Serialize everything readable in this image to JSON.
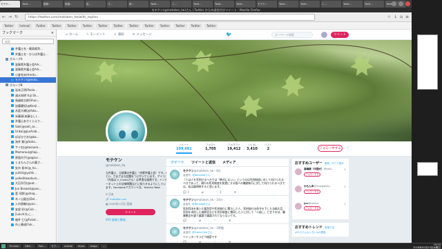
{
  "browser": {
    "tabs": [
      "モテケ…",
      "Twitt…",
      "国際…",
      "英国…",
      "民…",
      "コ…",
      "新…",
      "Twitt…",
      "ニ…",
      "Twitt…",
      "Twitt…",
      "Twitt…",
      "モテケ…",
      "Twitt…",
      "Twitt…",
      "ニ…",
      "Twitt…",
      "Twitt…",
      "Twitt…"
    ],
    "active_tab_index": 0,
    "window_title": "モテケン(@motoken_tw)さん | Twitter からの返信付きツイート - Mozilla Firefox",
    "url": "https://twitter.com/motoken_tw/with_replies",
    "bookmarks": [
      "Twitter",
      "hotmail",
      "Twitter",
      "Twitter",
      "Twitter",
      "Twitter",
      "Twitter",
      "Twitter",
      "Twitter",
      "Twitter",
      "Twitter",
      "Twitter",
      "Twitter",
      "Twitter"
    ]
  },
  "sidebar": {
    "title": "ブックマーク",
    "search_placeholder": "検索",
    "items": [
      {
        "label": "弁護士名・最高裁判…",
        "type": "item",
        "indent": 2
      },
      {
        "label": "弁護士名・ひらば弁護士…",
        "type": "item",
        "indent": 2
      },
      {
        "label": "グループA",
        "type": "folder",
        "indent": 1
      },
      {
        "label": "滋賀県弁護士会Ark…",
        "type": "item",
        "indent": 2
      },
      {
        "label": "滋賀県弁護士会Ark…",
        "type": "item",
        "indent": 2
      },
      {
        "label": "小倉秀夫(Hirofu…",
        "type": "item",
        "indent": 2
      },
      {
        "label": "モテケン(@moto…",
        "type": "item",
        "indent": 2,
        "selected": true
      },
      {
        "label": "グループB",
        "type": "folder",
        "indent": 1
      },
      {
        "label": "岩本正明(Poole…",
        "type": "item",
        "indent": 2
      },
      {
        "label": "清水知明 Yuji Sh…",
        "type": "item",
        "indent": 2
      },
      {
        "label": "鳥越俊太郎(Shun…",
        "type": "item",
        "indent": 2
      },
      {
        "label": "加藤慶紀(@Kenji…",
        "type": "item",
        "indent": 2
      },
      {
        "label": "木庭大補(@Yoka…",
        "type": "item",
        "indent": 2
      },
      {
        "label": "米藤東(米藤なし)…",
        "type": "item",
        "indent": 2
      },
      {
        "label": "弁護士あさくらえり…",
        "type": "item",
        "indent": 2
      },
      {
        "label": "Saki(@saki_sa…",
        "type": "item",
        "indent": 2
      },
      {
        "label": "Uriko(@JuxArab…",
        "type": "item",
        "indent": 2
      },
      {
        "label": "ばばひさお(@ba…",
        "type": "item",
        "indent": 2
      },
      {
        "label": "海井 紫(@Soho…",
        "type": "item",
        "indent": 2
      },
      {
        "label": "サイ右(@kasaum…",
        "type": "item",
        "indent": 2
      },
      {
        "label": "Mamorou(@hap…",
        "type": "item",
        "indent": 2
      },
      {
        "label": "原面内子(@agour…",
        "type": "item",
        "indent": 2
      },
      {
        "label": "くまもんさんの妻さ…",
        "type": "item",
        "indent": 2
      },
      {
        "label": "矢市 晋市(@_ho…",
        "type": "item",
        "indent": 2
      },
      {
        "label": "yuhki(@yuhki…",
        "type": "item",
        "indent": 2
      },
      {
        "label": "yoike(Kawakuro…",
        "type": "item",
        "indent": 2
      },
      {
        "label": "大石早月(@sat…",
        "type": "item",
        "indent": 2
      },
      {
        "label": "Jun Boswal(@you…",
        "type": "item",
        "indent": 2
      },
      {
        "label": "葛 司郎(@shoq…",
        "type": "item",
        "indent": 2
      },
      {
        "label": "木ノ山屋吉(Dol…",
        "type": "item",
        "indent": 2
      },
      {
        "label": "入内島敏(@yon…",
        "type": "item",
        "indent": 2
      },
      {
        "label": "安部 好(@Coic…",
        "type": "item",
        "indent": 2
      },
      {
        "label": "[Lukch]もこ…",
        "type": "item",
        "indent": 2
      },
      {
        "label": "福井 仁(@Fukut…",
        "type": "item",
        "indent": 2
      },
      {
        "label": "市上康成(Fuk…",
        "type": "item",
        "indent": 2
      }
    ]
  },
  "twitter_nav": {
    "home": "ホーム",
    "moments": "モーメント",
    "notifications": "通知",
    "messages": "メッセージ",
    "search_placeholder": "キーワード検索",
    "tweet_button": "ツイート"
  },
  "stats": [
    {
      "label": "ツイート",
      "value": "109,661"
    },
    {
      "label": "フォロー",
      "value": "1,705"
    },
    {
      "label": "フォロワー",
      "value": "19,412"
    },
    {
      "label": "いいね",
      "value": "3,410"
    },
    {
      "label": "リスト",
      "value": "2"
    }
  ],
  "follow_button": "フォロー中する",
  "profile": {
    "name": "モテケン",
    "handle": "@motoken_tw",
    "bio": "元弁護士、元検事の弁護士（京都弁護士会）です。HとO、さまざまな話題をつぶやいています。アイコン（作画は V_Cinelaさん）は草食な風物です。インターネット上の法律問題などに知らせるようにしています。Facebookアカウントは、Yoshiro Yabe",
    "location": "日本",
    "site": "motoken.net",
    "joined": "2009年12月に登録",
    "tweet_button": "ツイート",
    "media_link": "950 画像と動画"
  },
  "timeline": {
    "tabs": [
      "ツイート",
      "ツイートと返信",
      "メディア"
    ],
    "active_tab": 0,
    "tweets": [
      {
        "name": "モテケン",
        "handle": "@motoken_tw",
        "time": "・8分",
        "reply_to": "@Nikaido6さん",
        "text": "「人は人を死刑せるべきでは『絶対にない』」というのは死刑制度に対して向けられるべきであって、現行の死刑制度を前提にする個人の職務執行に対して向けられるべきでは、私は疑問視すると思います。",
        "replies": "1",
        "retweets": "",
        "likes": "2"
      },
      {
        "name": "モテケン",
        "handle": "@motoken_tw",
        "time": "・14分",
        "reply_to": "@Nikaido6さん",
        "text": "死刑判決を書いた裁判官や死刑執行に関与した人、死刑執行の命令を下した法務大臣、死刑を求刑した検察官などを死刑制度に賛同した人に対して「人殺し」と言うのは、職業観念を疑う議論で議論されてならないです。",
        "replies": "",
        "retweets": "",
        "likes": ""
      },
      {
        "name": "モテケン",
        "handle": "@motoken_tw",
        "time": "・1時間",
        "reply_to": "@Yukin2004さん",
        "text": "ツイッターでコピペ検索です",
        "replies": "",
        "retweets": "",
        "likes": ""
      }
    ]
  },
  "suggestions": {
    "title": "おすすめユーザー",
    "refresh": "更新",
    "view_all": "すべて表示",
    "users": [
      {
        "name": "高嶋康（中国ゼ）",
        "handle": "@taka…",
        "follow": "フォローする"
      },
      {
        "name": "わもん本",
        "handle": "@moegoighi…",
        "follow": "フォローする"
      },
      {
        "name": "jce",
        "handle": "@tiastos",
        "follow": "フォローする"
      }
    ]
  },
  "trends": {
    "title": "おすすめトレンド",
    "change": "変更する",
    "items": [
      "#ロスクムカンちレキ5週前"
    ]
  },
  "taskbar": {
    "items": [
      "Thunder",
      "GNU…",
      "Twit…",
      "モテ…",
      "ecktok",
      "eiyes",
      "xtego",
      "…"
    ],
    "time": "19:53",
    "date": "2018年05月23日水曜日"
  }
}
